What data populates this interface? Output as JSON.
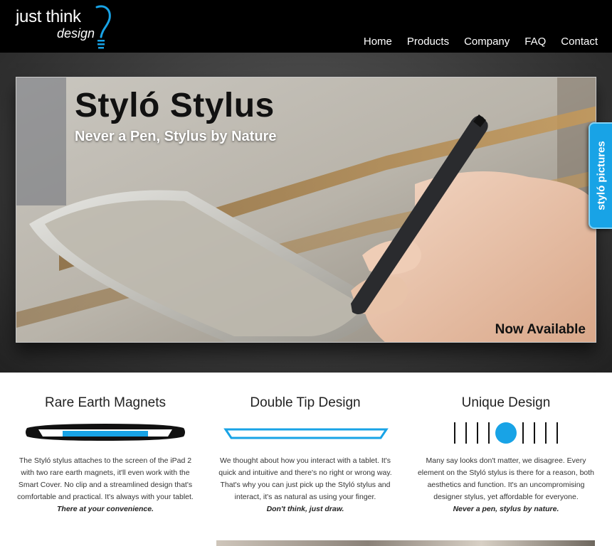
{
  "brand": {
    "line1": "just think",
    "line2": "design"
  },
  "nav": [
    "Home",
    "Products",
    "Company",
    "FAQ",
    "Contact"
  ],
  "hero": {
    "title": "Styló Stylus",
    "subtitle": "Never a Pen, Stylus by Nature",
    "badge": "Now Available",
    "side_tab": "styló pictures"
  },
  "features": [
    {
      "title": "Rare Earth Magnets",
      "body": "The Styló stylus attaches to the screen of the iPad 2 with two rare earth magnets, it'll even work with the Smart Cover. No clip and a streamlined design that's comfortable and practical. It's always with your tablet.",
      "tagline": "There at your convenience."
    },
    {
      "title": "Double Tip Design",
      "body": "We thought about how you interact with a tablet. It's quick and intuitive and there's no right or wrong way. That's why you can just pick up the Styló stylus and interact, it's as natural as using your finger.",
      "tagline": "Don't think, just draw."
    },
    {
      "title": "Unique Design",
      "body": "Many say looks don't matter, we disagree. Every element on the Styló stylus is there for a reason, both aesthetics and function. It's an uncompromising designer stylus, yet affordable for everyone.",
      "tagline": "Never a pen, stylus by nature."
    }
  ],
  "colors": {
    "accent": "#18a3e6",
    "header_bg": "#000000"
  },
  "icons": [
    "lightbulb-icon"
  ]
}
